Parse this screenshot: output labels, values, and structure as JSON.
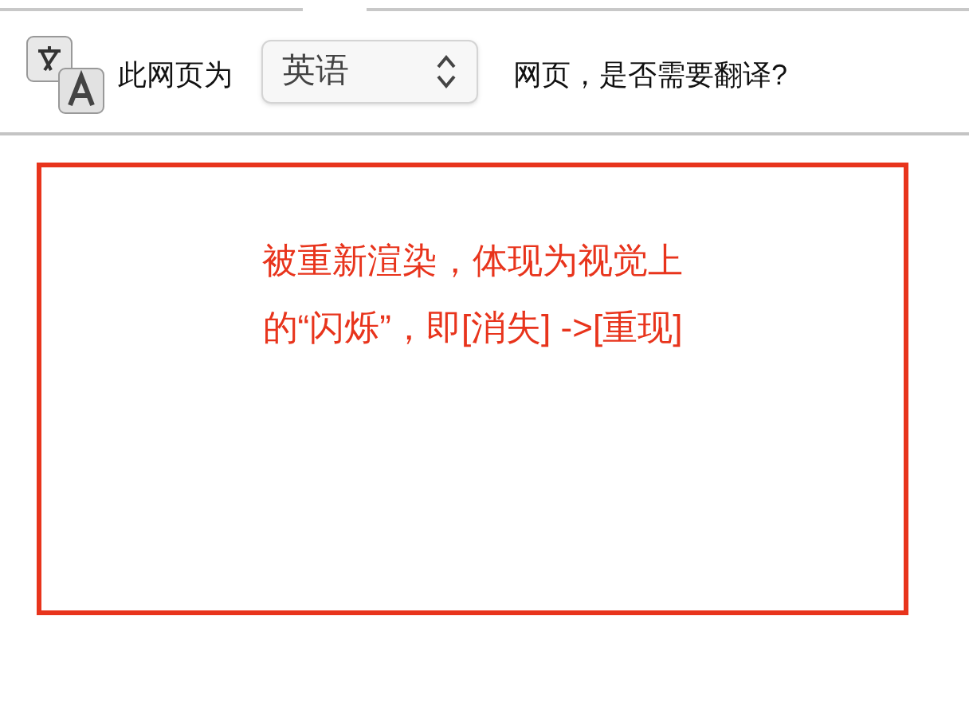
{
  "translate_bar": {
    "prefix": "此网页为",
    "language_select": {
      "value": "英语"
    },
    "suffix": "网页，是否需要翻译?"
  },
  "annotation": {
    "lines": [
      "被重新渲染，体现为视觉上",
      "的“闪烁”，即[消失] ->[重现]"
    ]
  }
}
